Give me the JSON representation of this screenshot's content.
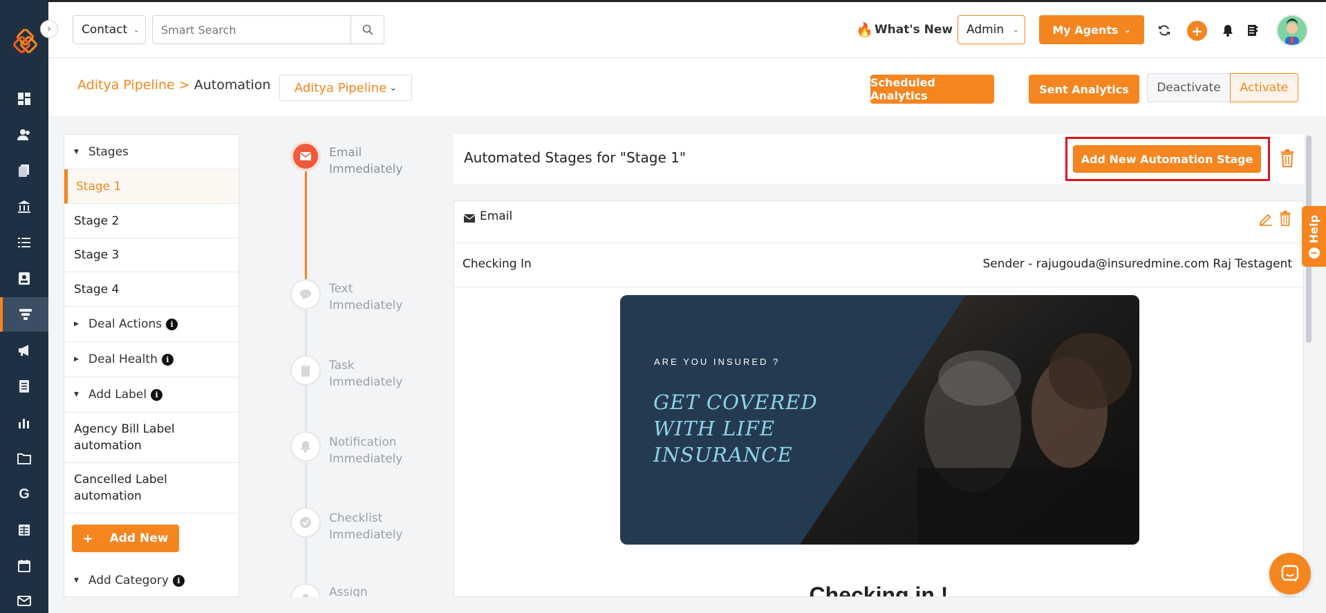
{
  "header": {
    "module_select": "Contact",
    "search_placeholder": "Smart Search",
    "whats_new": "What's New",
    "role_select": "Admin",
    "my_agents": "My Agents"
  },
  "subheader": {
    "breadcrumb_pipeline": "Aditya Pipeline",
    "breadcrumb_separator": ">",
    "breadcrumb_page": "Automation",
    "pipeline_select": "Aditya Pipeline",
    "scheduled_analytics": "Scheduled Analytics",
    "sent_analytics": "Sent Analytics",
    "deactivate": "Deactivate",
    "activate": "Activate"
  },
  "stages_panel": {
    "stages_header": "Stages",
    "stages": [
      "Stage 1",
      "Stage 2",
      "Stage 3",
      "Stage 4"
    ],
    "deal_actions": "Deal Actions",
    "deal_health": "Deal Health",
    "add_label": "Add Label",
    "labels": [
      "Agency Bill Label automation",
      "Cancelled Label automation"
    ],
    "add_new": "Add New",
    "add_category": "Add Category"
  },
  "timeline": [
    {
      "type": "Email",
      "when": "Immediately",
      "icon": "envelope-icon"
    },
    {
      "type": "Text",
      "when": "Immediately",
      "icon": "chat-icon"
    },
    {
      "type": "Task",
      "when": "Immediately",
      "icon": "clipboard-icon"
    },
    {
      "type": "Notification",
      "when": "Immediately",
      "icon": "bell-icon"
    },
    {
      "type": "Checklist",
      "when": "Immediately",
      "icon": "check-circle-icon"
    },
    {
      "type": "Assign",
      "when": "",
      "icon": "user-icon"
    }
  ],
  "main": {
    "title": "Automated Stages for \"Stage 1\"",
    "add_stage_button": "Add New Automation Stage",
    "email_card": {
      "kind": "Email",
      "subject": "Checking In",
      "sender": "Sender - rajugouda@insuredmine.com Raj Testagent",
      "hero_kicker": "ARE YOU INSURED ?",
      "hero_line1": "GET COVERED",
      "hero_line2": "WITH LIFE",
      "hero_line3": "INSURANCE",
      "body_heading": "Checking in !"
    }
  },
  "help_tab": "Help",
  "colors": {
    "brand_orange": "#f5851f",
    "rail_navy": "#1f3042",
    "hero_navy": "#243a51",
    "hero_text": "#8fd3e8",
    "highlight_red": "#e0101a"
  }
}
